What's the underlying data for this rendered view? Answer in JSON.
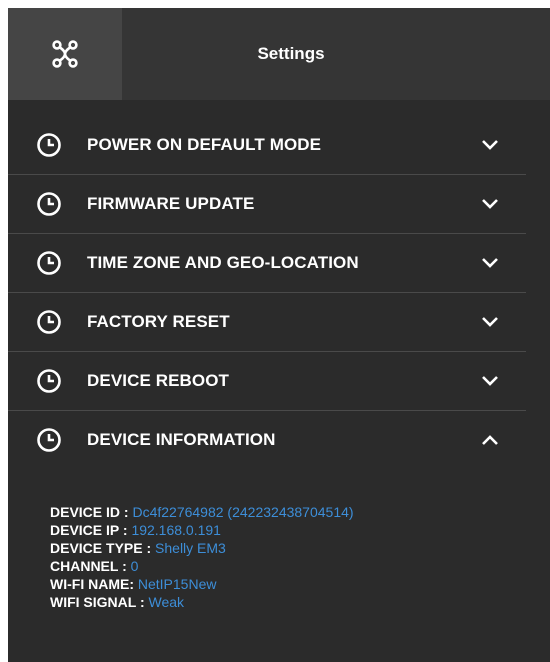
{
  "header": {
    "title": "Settings",
    "icon": "network-nodes-icon"
  },
  "sections": [
    {
      "label": "POWER ON DEFAULT MODE",
      "icon": "clock-icon",
      "expanded": false
    },
    {
      "label": "FIRMWARE UPDATE",
      "icon": "clock-icon",
      "expanded": false
    },
    {
      "label": "TIME ZONE AND GEO-LOCATION",
      "icon": "clock-icon",
      "expanded": false
    },
    {
      "label": "FACTORY RESET",
      "icon": "clock-icon",
      "expanded": false
    },
    {
      "label": "DEVICE REBOOT",
      "icon": "clock-icon",
      "expanded": false
    },
    {
      "label": "DEVICE INFORMATION",
      "icon": "clock-icon",
      "expanded": true
    }
  ],
  "device_info": {
    "device_id_label": "DEVICE ID :",
    "device_id_value": "Dc4f22764982 (242232438704514)",
    "device_ip_label": "DEVICE IP :",
    "device_ip_value": "192.168.0.191",
    "device_type_label": "DEVICE TYPE :",
    "device_type_value": "Shelly EM3",
    "channel_label": "CHANNEL :",
    "channel_value": "0",
    "wifi_name_label": "WI-FI NAME:",
    "wifi_name_value": "NetIP15New",
    "wifi_signal_label": "WIFI SIGNAL :",
    "wifi_signal_value": "Weak"
  },
  "colors": {
    "background": "#2b2b2b",
    "header": "#353535",
    "header_icon_box": "#454545",
    "value_blue": "#3d8ed8",
    "text": "#ffffff"
  }
}
